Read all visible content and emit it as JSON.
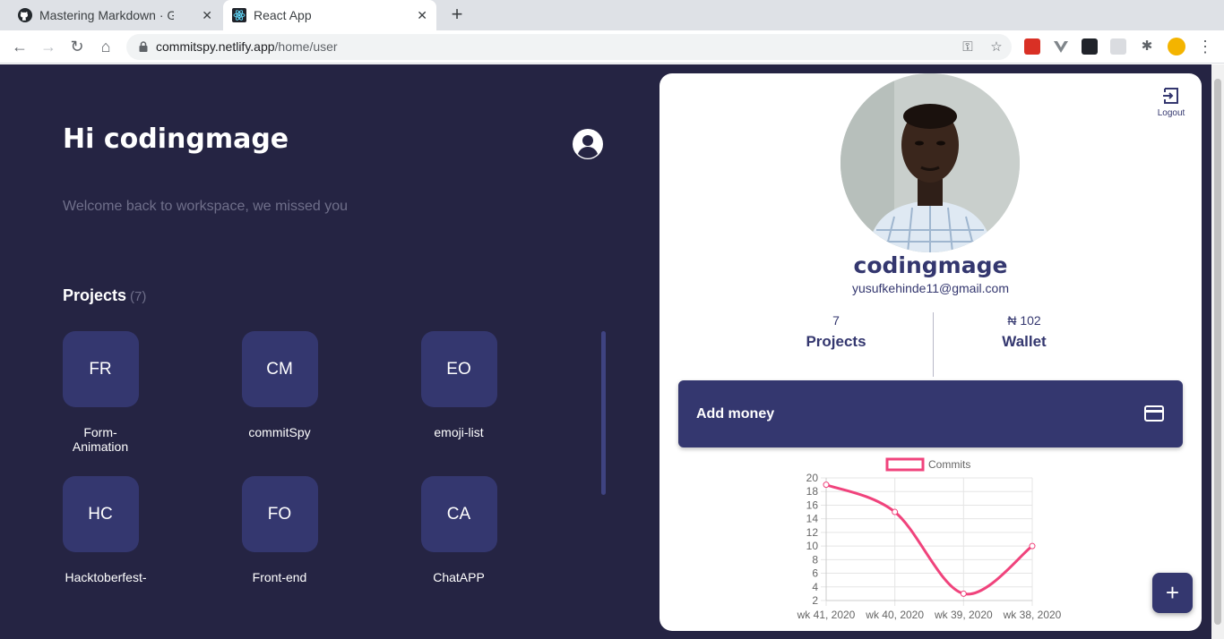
{
  "browser": {
    "tabs": [
      {
        "title": "Mastering Markdown · GitHub",
        "icon": "github-icon"
      },
      {
        "title": "React App",
        "icon": "react-icon"
      }
    ],
    "url_host": "commitspy.netlify.app",
    "url_path": "/home/user"
  },
  "header": {
    "greeting": "Hi codingmage",
    "subtitle": "Welcome back to workspace, we missed you"
  },
  "projects": {
    "heading": "Projects",
    "count": "(7)",
    "items": [
      {
        "initials": "FR",
        "name": "Form-Animation"
      },
      {
        "initials": "CM",
        "name": "commitSpy"
      },
      {
        "initials": "EO",
        "name": "emoji-list"
      },
      {
        "initials": "HC",
        "name": "Hacktoberfest-"
      },
      {
        "initials": "FO",
        "name": "Front-end"
      },
      {
        "initials": "CA",
        "name": "ChatAPP"
      }
    ]
  },
  "profile": {
    "logout_label": "Logout",
    "username": "codingmage",
    "email": "yusufkehinde11@gmail.com",
    "projects_value": "7",
    "projects_label": "Projects",
    "wallet_value": "₦ 102",
    "wallet_label": "Wallet",
    "add_money_label": "Add money",
    "fab_label": "+"
  },
  "chart_data": {
    "type": "line",
    "legend": "Commits",
    "categories": [
      "wk 41, 2020",
      "wk 40, 2020",
      "wk 39, 2020",
      "wk 38, 2020"
    ],
    "values": [
      19,
      15,
      3,
      10
    ],
    "ylim": [
      2,
      20
    ],
    "yticks": [
      2,
      4,
      6,
      8,
      10,
      12,
      14,
      16,
      18,
      20
    ],
    "color": "#f0437c",
    "grid": true,
    "legend_position": "top"
  },
  "colors": {
    "app_bg": "#252443",
    "accent": "#34376f",
    "line": "#f0437c"
  }
}
